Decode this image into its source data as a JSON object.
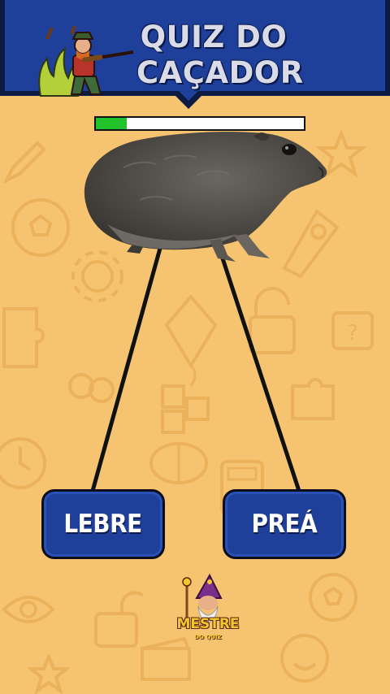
{
  "header": {
    "title_line1": "QUIZ DO",
    "title_line2": "CAÇADOR",
    "colors": {
      "banner": "#1e3f9a",
      "banner_dark": "#0c1a44",
      "title": "#d9dbe6"
    }
  },
  "progress": {
    "value_percent": 15,
    "fill_color": "#22c32a"
  },
  "question": {
    "image": "guinea-pig-photo"
  },
  "answers": [
    {
      "label": "LEBRE"
    },
    {
      "label": "PREÁ"
    }
  ],
  "logo": {
    "line1": "MESTRE",
    "line2": "DO QUIZ"
  },
  "background": {
    "color": "#f6c470",
    "doodle_color": "#e8a850"
  }
}
